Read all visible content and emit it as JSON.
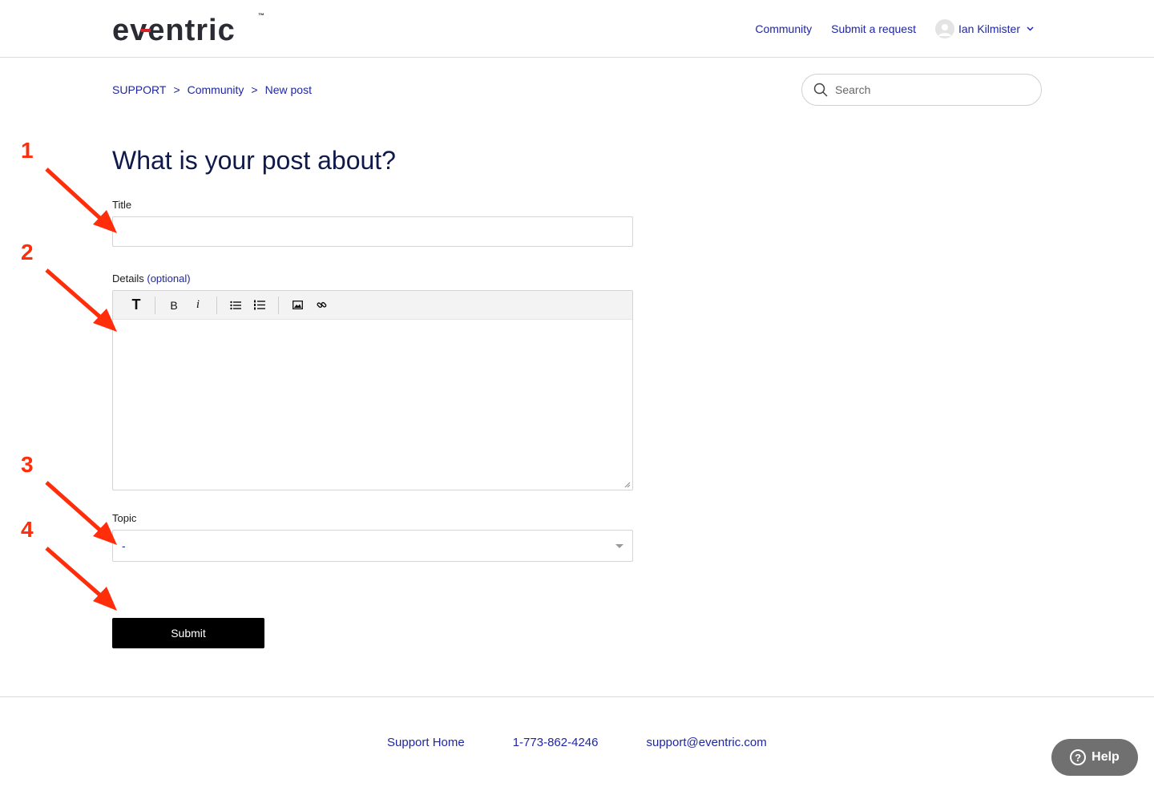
{
  "brand": {
    "logo_text": "eventric",
    "trademark": "™",
    "accent_color": "#1f26a3",
    "logo_color": "#2b2b33",
    "logo_accent": "#d6202a"
  },
  "header": {
    "nav": [
      {
        "label": "Community"
      },
      {
        "label": "Submit a request"
      }
    ],
    "user": {
      "name": "Ian Kilmister",
      "chevron": "chevron-down-icon"
    }
  },
  "breadcrumbs": [
    {
      "label": "SUPPORT"
    },
    {
      "label": "Community"
    },
    {
      "label": "New post"
    }
  ],
  "breadcrumb_separator": ">",
  "search": {
    "placeholder": "Search",
    "icon": "search-icon"
  },
  "form": {
    "heading": "What is your post about?",
    "title_label": "Title",
    "title_value": "",
    "details_label": "Details",
    "details_optional": "(optional)",
    "toolbar": {
      "text_style": "T",
      "bold": "B",
      "italic": "i",
      "icons": [
        "text-style-icon",
        "bold-icon",
        "italic-icon",
        "bulleted-list-icon",
        "numbered-list-icon",
        "image-icon",
        "link-icon"
      ]
    },
    "topic_label": "Topic",
    "topic_value": "-",
    "submit_label": "Submit"
  },
  "annotations": {
    "numbers": [
      "1",
      "2",
      "3",
      "4"
    ],
    "color": "#ff2d0a"
  },
  "footer": {
    "links": [
      {
        "label": "Support Home"
      },
      {
        "label": "1-773-862-4246"
      },
      {
        "label": "support@eventric.com"
      }
    ]
  },
  "help_widget": {
    "label": "Help",
    "icon": "question-circle-icon"
  }
}
